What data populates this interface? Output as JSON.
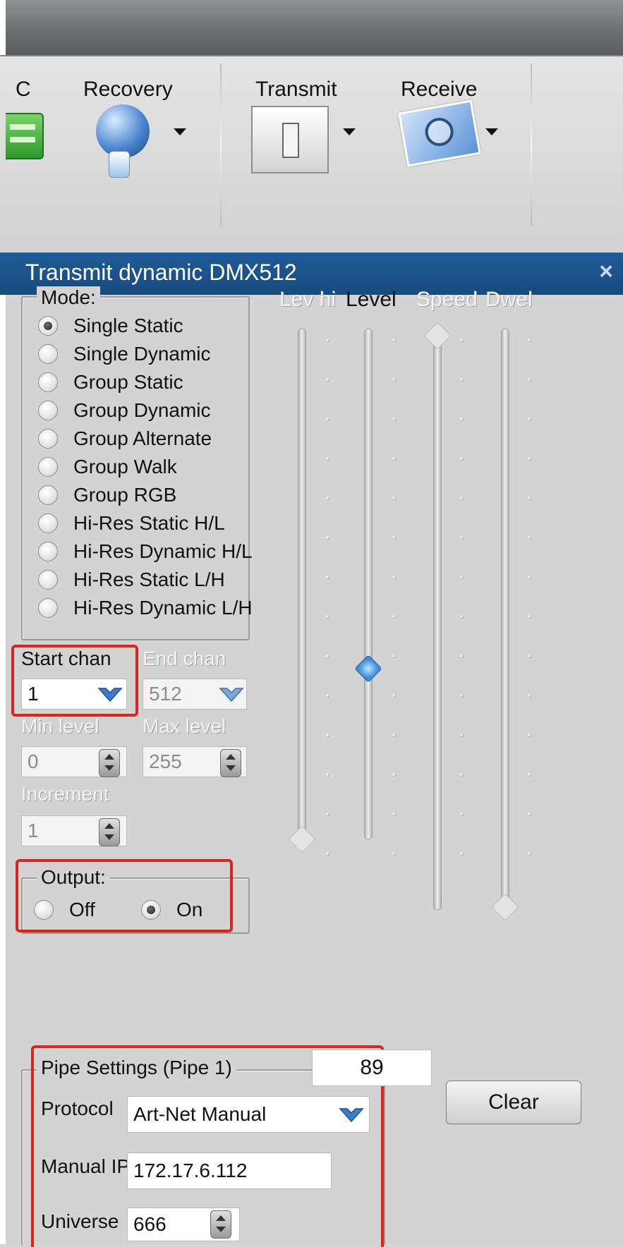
{
  "ribbon": {
    "partial_label": "C",
    "recovery_label": "Recovery",
    "transmit_label": "Transmit",
    "receive_label": "Receive"
  },
  "panel": {
    "title": "Transmit dynamic DMX512",
    "close_glyph": "×"
  },
  "mode": {
    "legend": "Mode:",
    "options": [
      {
        "label": "Single Static",
        "selected": true
      },
      {
        "label": "Single Dynamic",
        "selected": false
      },
      {
        "label": "Group Static",
        "selected": false
      },
      {
        "label": "Group Dynamic",
        "selected": false
      },
      {
        "label": "Group Alternate",
        "selected": false
      },
      {
        "label": "Group Walk",
        "selected": false
      },
      {
        "label": "Group RGB",
        "selected": false
      },
      {
        "label": "Hi-Res Static H/L",
        "selected": false
      },
      {
        "label": "Hi-Res Dynamic H/L",
        "selected": false
      },
      {
        "label": "Hi-Res Static L/H",
        "selected": false
      },
      {
        "label": "Hi-Res Dynamic L/H",
        "selected": false
      }
    ]
  },
  "fields": {
    "start_chan_label": "Start  chan",
    "start_chan_value": "1",
    "end_chan_label": "End chan",
    "end_chan_value": "512",
    "min_level_label": "Min level",
    "min_level_value": "0",
    "max_level_label": "Max level",
    "max_level_value": "255",
    "increment_label": "Increment",
    "increment_value": "1"
  },
  "output": {
    "legend": "Output:",
    "off_label": "Off",
    "on_label": "On",
    "selected": "On"
  },
  "pipe": {
    "legend": "Pipe Settings (Pipe 1)",
    "protocol_label": "Protocol",
    "protocol_value": "Art-Net Manual",
    "manual_ip_label": "Manual IP",
    "manual_ip_value": "172.17.6.112",
    "universe_label": "Universe",
    "universe_value": "666"
  },
  "sliders": {
    "lev_hi_label": "Lev hi",
    "level_label": "Level",
    "speed_label": "Speed",
    "dwell_label": "Dwel",
    "level_value": "89"
  },
  "clear_label": "Clear",
  "colors": {
    "title_bar": "#1f5c97",
    "highlight": "#e0221f",
    "thumb_blue": "#3f8fd8"
  }
}
